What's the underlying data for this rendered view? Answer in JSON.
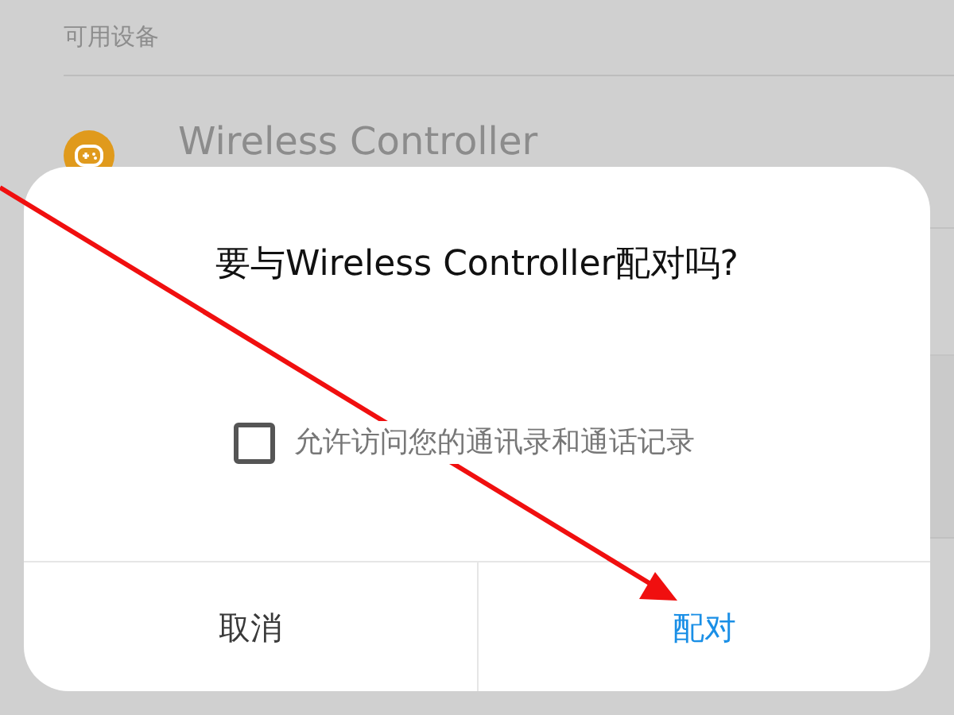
{
  "section_header": "可用设备",
  "device": {
    "name": "Wireless Controller"
  },
  "dialog": {
    "title": "要与Wireless Controller配对吗?",
    "checkbox": {
      "label": "允许访问您的通讯录和通话记录",
      "checked": false
    },
    "buttons": [
      {
        "label": "取消",
        "kind": "cancel"
      },
      {
        "label": "配对",
        "kind": "confirm"
      }
    ]
  }
}
